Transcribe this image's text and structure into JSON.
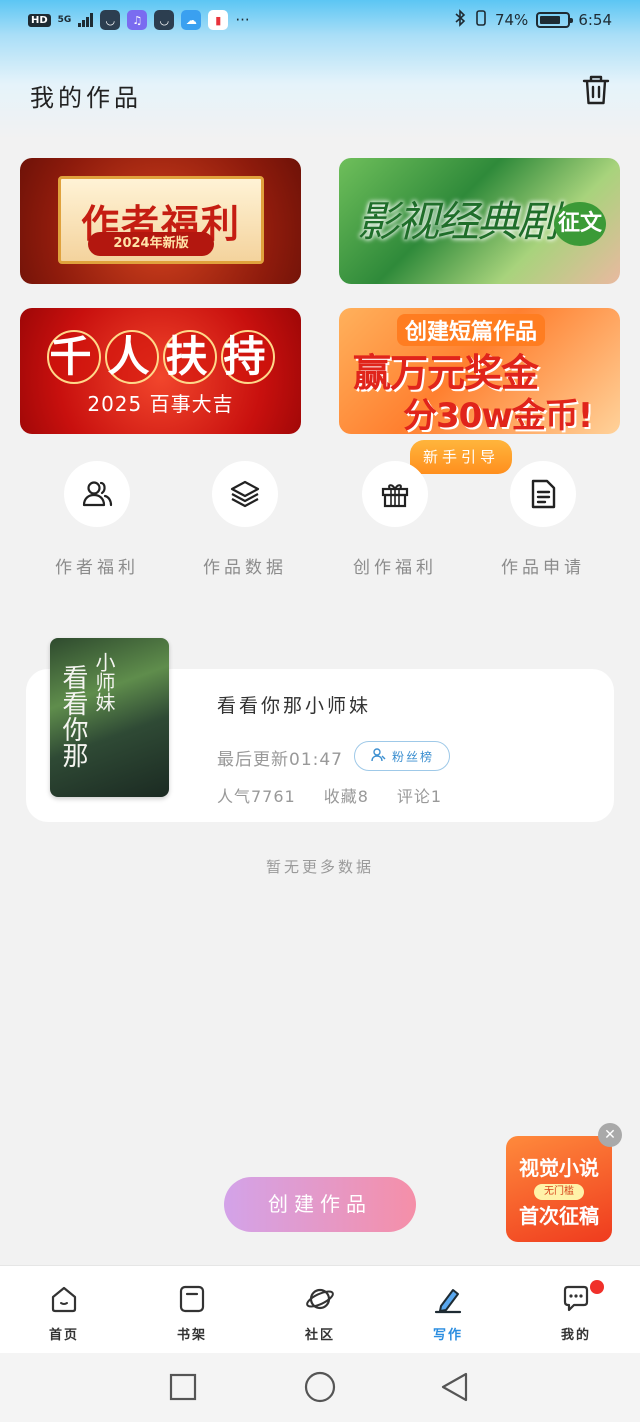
{
  "status_bar": {
    "hd": "HD",
    "network": "5G",
    "battery_percent": "74%",
    "time": "6:54",
    "more": "···"
  },
  "header": {
    "title": "我的作品",
    "trash_icon": "trash-icon"
  },
  "banners": [
    {
      "title": "作者福利",
      "subtitle": "2024年新版"
    },
    {
      "title": "影视经典剧",
      "tag": "征文"
    },
    {
      "title": "千人扶持",
      "subtitle": "2025 百事大吉"
    },
    {
      "line1": "创建短篇作品",
      "line2": "赢万元奖金",
      "line3": "分30w金币!"
    }
  ],
  "guide_tag": "新手引导",
  "quick_actions": [
    {
      "label": "作者福利",
      "icon": "users-icon"
    },
    {
      "label": "作品数据",
      "icon": "layers-icon"
    },
    {
      "label": "创作福利",
      "icon": "gift-icon"
    },
    {
      "label": "作品申请",
      "icon": "document-icon"
    }
  ],
  "work": {
    "title": "看看你那小师妹",
    "cover_title": "看看你那",
    "cover_title2": "小师妹",
    "last_update": "最后更新01:47",
    "fans_button": "粉丝榜",
    "popularity": "人气7761",
    "favorites": "收藏8",
    "comments": "评论1"
  },
  "no_more": "暂无更多数据",
  "float_ad": {
    "line1": "视觉小说",
    "line2": "无门槛",
    "line3": "首次征稿"
  },
  "create_button": "创建作品",
  "tabs": [
    {
      "label": "首页",
      "icon": "home-icon"
    },
    {
      "label": "书架",
      "icon": "bookshelf-icon"
    },
    {
      "label": "社区",
      "icon": "planet-icon"
    },
    {
      "label": "写作",
      "icon": "pen-icon",
      "active": true
    },
    {
      "label": "我的",
      "icon": "chat-bubble-icon"
    }
  ],
  "colors": {
    "accent": "#2a8de0",
    "create_start": "#d3a3e9",
    "create_end": "#f58fa8",
    "badge": "#f0302a"
  }
}
